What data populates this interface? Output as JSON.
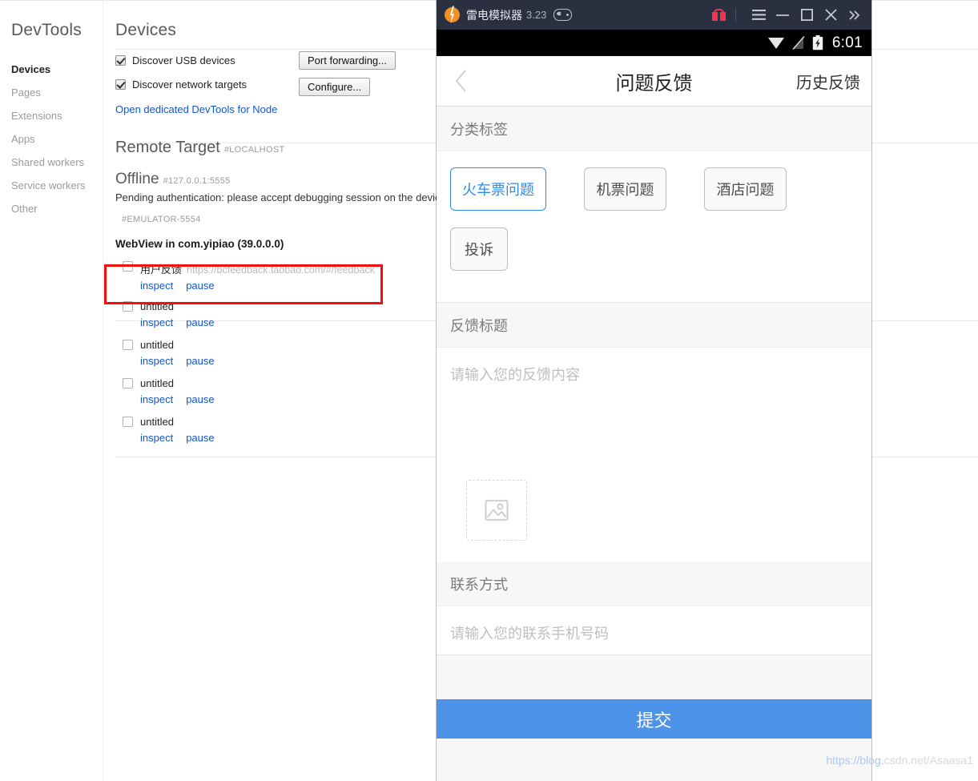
{
  "devtools": {
    "logo": "DevTools",
    "nav_items": [
      {
        "label": "Devices",
        "active": true
      },
      {
        "label": "Pages",
        "active": false
      },
      {
        "label": "Extensions",
        "active": false
      },
      {
        "label": "Apps",
        "active": false
      },
      {
        "label": "Shared workers",
        "active": false
      },
      {
        "label": "Service workers",
        "active": false
      },
      {
        "label": "Other",
        "active": false
      }
    ],
    "page_title": "Devices",
    "discover_usb": "Discover USB devices",
    "discover_network": "Discover network targets",
    "port_forwarding_button": "Port forwarding...",
    "configure_button": "Configure...",
    "node_link": "Open dedicated DevTools for Node",
    "remote_target_title": "Remote Target",
    "remote_target_id": "#LOCALHOST",
    "offline_title": "Offline",
    "offline_id": "#127.0.0.1:5555",
    "pending_text": "Pending authentication: please accept debugging session on the device.",
    "emulator_id": "#EMULATOR-5554",
    "webview_title": "WebView in com.yipiao (39.0.0.0)",
    "targets": [
      {
        "name": "用户反馈",
        "url": "https://bcfeedback.taobao.com/#/feedback",
        "inspect": "inspect",
        "pause": "pause",
        "highlighted": true
      },
      {
        "name": "untitled",
        "url": "",
        "inspect": "inspect",
        "pause": "pause",
        "highlighted": false
      },
      {
        "name": "untitled",
        "url": "",
        "inspect": "inspect",
        "pause": "pause",
        "highlighted": false
      },
      {
        "name": "untitled",
        "url": "",
        "inspect": "inspect",
        "pause": "pause",
        "highlighted": false
      },
      {
        "name": "untitled",
        "url": "",
        "inspect": "inspect",
        "pause": "pause",
        "highlighted": false
      }
    ],
    "highlight_color": "#f40f0f",
    "link_color": "#1155cc"
  },
  "emulator": {
    "title": "雷电模拟器",
    "version": "3.23",
    "titlebar_color": "#2b3040",
    "gift_color": "#f7324c",
    "controls": {
      "gift": "gift-icon",
      "menu": "hamburger-menu-icon",
      "minimize": "minimize-icon",
      "maximize": "maximize-icon",
      "close": "close-icon",
      "expand": "double-chevron-right-icon"
    },
    "statusbar": {
      "wifi": "wifi-icon",
      "signal": "signal-off-icon",
      "battery": "battery-charging-icon",
      "time": "6:01"
    }
  },
  "app": {
    "header": {
      "back": "back-chevron-icon",
      "title": "问题反馈",
      "history_label": "历史反馈"
    },
    "category_section": {
      "label": "分类标签",
      "chips": [
        {
          "label": "火车票问题",
          "selected": true
        },
        {
          "label": "机票问题",
          "selected": false
        },
        {
          "label": "酒店问题",
          "selected": false
        },
        {
          "label": "投诉",
          "selected": false
        }
      ],
      "selected_color": "#2d8cf0"
    },
    "feedback_section": {
      "label": "反馈标题",
      "content_placeholder": "请输入您的反馈内容",
      "content_value": "",
      "upload_icon": "image-placeholder-icon"
    },
    "contact_section": {
      "label": "联系方式",
      "phone_placeholder": "请输入您的联系手机号码",
      "phone_value": ""
    },
    "submit_label": "提交",
    "submit_color": "#4d94e8"
  },
  "watermark": {
    "prefix": "https://blog.",
    "suffix": "csdn.net/Asaasa1"
  }
}
